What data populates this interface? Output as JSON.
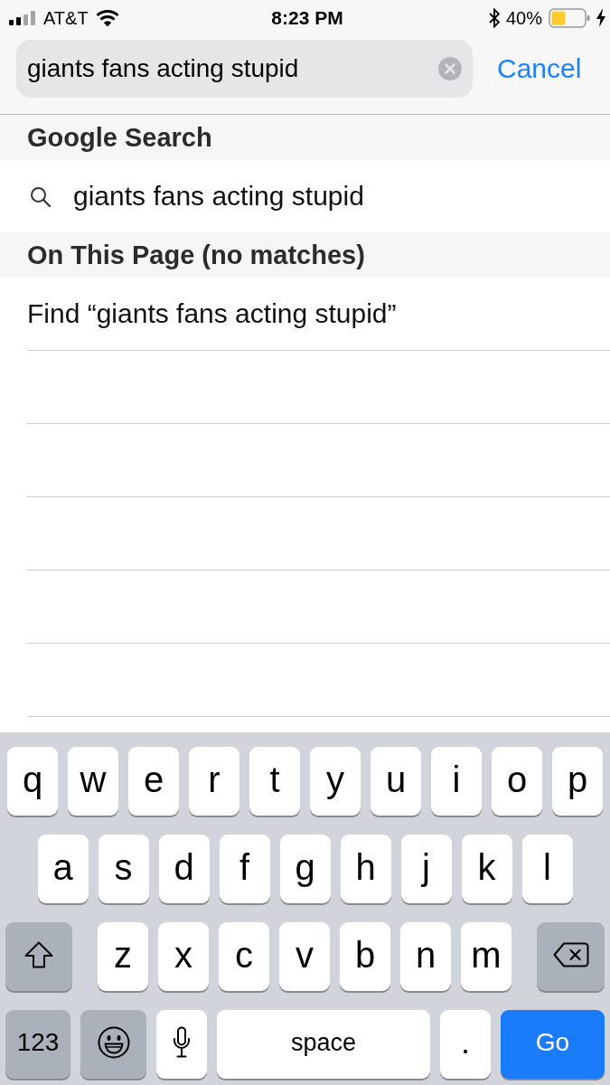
{
  "status_bar": {
    "carrier": "AT&T",
    "time": "8:23 PM",
    "battery": "40%"
  },
  "search_bar": {
    "value": "giants fans acting stupid",
    "cancel_label": "Cancel"
  },
  "sections": [
    {
      "title": "Google Search",
      "items": [
        {
          "kind": "suggestion",
          "text": "giants fans acting stupid"
        }
      ]
    },
    {
      "title": "On This Page (no matches)",
      "items": [
        {
          "kind": "find",
          "text": "Find “giants fans acting stupid”"
        }
      ]
    }
  ],
  "keyboard": {
    "rows": [
      {
        "keys": [
          {
            "kind": "letter",
            "label": "q"
          },
          {
            "kind": "letter",
            "label": "w"
          },
          {
            "kind": "letter",
            "label": "e"
          },
          {
            "kind": "letter",
            "label": "r"
          },
          {
            "kind": "letter",
            "label": "t"
          },
          {
            "kind": "letter",
            "label": "y"
          },
          {
            "kind": "letter",
            "label": "u"
          },
          {
            "kind": "letter",
            "label": "i"
          },
          {
            "kind": "letter",
            "label": "o"
          },
          {
            "kind": "letter",
            "label": "p"
          }
        ]
      },
      {
        "keys": [
          {
            "kind": "letter",
            "label": "a"
          },
          {
            "kind": "letter",
            "label": "s"
          },
          {
            "kind": "letter",
            "label": "d"
          },
          {
            "kind": "letter",
            "label": "f"
          },
          {
            "kind": "letter",
            "label": "g"
          },
          {
            "kind": "letter",
            "label": "h"
          },
          {
            "kind": "letter",
            "label": "j"
          },
          {
            "kind": "letter",
            "label": "k"
          },
          {
            "kind": "letter",
            "label": "l"
          }
        ]
      },
      {
        "keys": [
          {
            "kind": "shift"
          },
          {
            "kind": "letter",
            "label": "z"
          },
          {
            "kind": "letter",
            "label": "x"
          },
          {
            "kind": "letter",
            "label": "c"
          },
          {
            "kind": "letter",
            "label": "v"
          },
          {
            "kind": "letter",
            "label": "b"
          },
          {
            "kind": "letter",
            "label": "n"
          },
          {
            "kind": "letter",
            "label": "m"
          },
          {
            "kind": "delete"
          }
        ]
      },
      {
        "keys": [
          {
            "kind": "numbers",
            "label": "123"
          },
          {
            "kind": "emoji"
          },
          {
            "kind": "dictation"
          },
          {
            "kind": "space",
            "label": "space"
          },
          {
            "kind": "period",
            "label": "."
          },
          {
            "kind": "go",
            "label": "Go"
          }
        ]
      }
    ]
  }
}
